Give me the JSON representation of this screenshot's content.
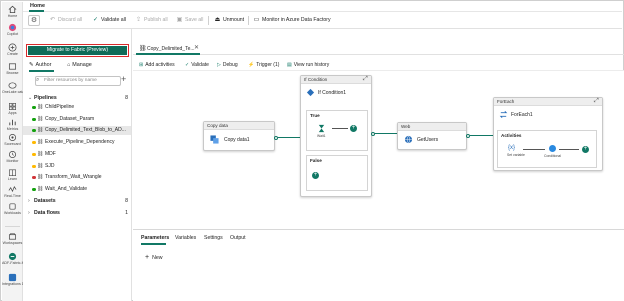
{
  "rail": {
    "items": [
      {
        "label": "Home",
        "icon": "home-icon"
      },
      {
        "label": "Copilot",
        "icon": "copilot-icon"
      },
      {
        "label": "Create",
        "icon": "create-icon"
      },
      {
        "label": "Browse",
        "icon": "browse-icon"
      },
      {
        "label": "OneLake catalog",
        "icon": "onelake-icon"
      },
      {
        "label": "Apps",
        "icon": "apps-icon"
      },
      {
        "label": "Metrics",
        "icon": "metrics-icon"
      },
      {
        "label": "Scorecard",
        "icon": "scorecard-icon"
      },
      {
        "label": "Monitor",
        "icon": "monitor-icon"
      },
      {
        "label": "Learn",
        "icon": "learn-icon"
      },
      {
        "label": "Real-Time",
        "icon": "realtime-icon"
      },
      {
        "label": "Workloads",
        "icon": "workloads-icon"
      },
      {
        "label": "Workspaces",
        "icon": "workspaces-icon"
      },
      {
        "label": "ADF-Fabric-Migration...",
        "icon": "adf-icon"
      },
      {
        "label": "Integrations Direct",
        "icon": "integrations-icon"
      }
    ]
  },
  "ribbon": {
    "home_tab": "Home",
    "discard": "Discard all",
    "validate": "Validate all",
    "publish": "Publish all",
    "save": "Save all",
    "unmount": "Unmount",
    "monitor": "Monitor in Azure Data Factory"
  },
  "explorer": {
    "migrate_button": "Migrate to Fabric (Preview)",
    "tab_author": "Author",
    "tab_manage": "Manage",
    "filter_placeholder": "Filter resources by name",
    "pipelines_label": "Pipelines",
    "pipelines_count": "8",
    "pipelines": [
      {
        "name": "ChildPipeline",
        "status_color": "#13a10e"
      },
      {
        "name": "Copy_Dataset_Param",
        "status_color": "#13a10e"
      },
      {
        "name": "Copy_Delimited_Text_Blob_to_AD...",
        "status_color": "#13a10e"
      },
      {
        "name": "Execute_Pipeline_Dependency",
        "status_color": "#ffb900"
      },
      {
        "name": "MDF",
        "status_color": "#ffb900"
      },
      {
        "name": "SJD",
        "status_color": "#ffb900"
      },
      {
        "name": "Transform_Wait_Wrangle",
        "status_color": "#d13438"
      },
      {
        "name": "Wait_And_Validate",
        "status_color": "#13a10e"
      }
    ],
    "datasets_label": "Datasets",
    "datasets_count": "8",
    "dataflows_label": "Data flows",
    "dataflows_count": "1"
  },
  "editor": {
    "doc_tab": "Copy_Delimited_Te...",
    "toolbar": {
      "add_activities": "Add activities",
      "validate": "Validate",
      "debug": "Debug",
      "trigger": "Trigger (1)",
      "run_history": "View run history"
    },
    "activities": {
      "copy_header": "Copy data",
      "copy_name": "Copy data1",
      "if_header": "If Condition",
      "if_name": "If Condition1",
      "true_label": "True",
      "wait_label": "Wait1",
      "false_label": "False",
      "web_header": "Web",
      "web_name": "GetUsers",
      "foreach_header": "ForEach",
      "foreach_name": "ForEach1",
      "activities_label": "Activities",
      "set_variable_label": "Set variable",
      "conditional_label": "Conditional"
    }
  },
  "bottom_panel": {
    "tabs": [
      "Parameters",
      "Variables",
      "Settings",
      "Output"
    ],
    "new_label": "New"
  },
  "colors": {
    "accent": "#117865",
    "migrate_bg": "#0f6b58",
    "highlight_border": "#d92b2b"
  }
}
